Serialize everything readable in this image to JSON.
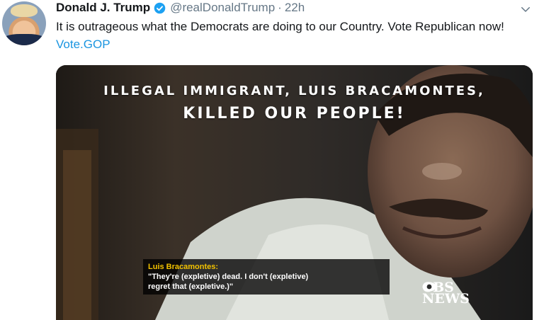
{
  "tweet": {
    "display_name": "Donald J. Trump",
    "handle": "@realDonaldTrump",
    "separator": "·",
    "time": "22h",
    "text": "It is outrageous what the Democrats are doing to our Country. Vote Republican now!",
    "link": "Vote.GOP",
    "verified": true
  },
  "video": {
    "headline_line1": "ILLEGAL IMMIGRANT, LUIS BRACAMONTES,",
    "headline_line2": "KILLED OUR PEOPLE!",
    "caption_speaker": "Luis Bracamontes:",
    "caption_line1": "\"They're (expletive) dead. I don't (expletive)",
    "caption_line2": "regret that (expletive.)\"",
    "watermark_line1": "CBS",
    "watermark_line2": "NEWS"
  },
  "colors": {
    "link": "#1b95e0",
    "verified_badge": "#1da1f2",
    "secondary_text": "#657786",
    "caption_speaker": "#f2c200"
  },
  "icons": {
    "verified": "verified-badge-icon",
    "menu": "chevron-down-icon",
    "watermark": "cbs-eye-icon"
  }
}
